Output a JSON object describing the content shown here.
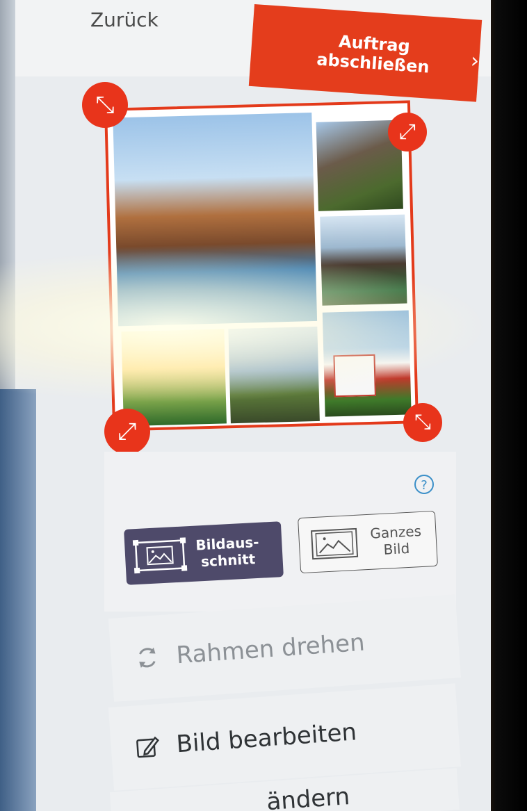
{
  "header": {
    "back_label": "Zurück",
    "finish_label": "Auftrag abschließen",
    "finish_chevron": "›"
  },
  "editor": {
    "help_label": "?",
    "handle_icons": [
      "resize-diagonal-icon",
      "resize-diagonal-icon",
      "resize-diagonal-icon",
      "resize-diagonal-icon"
    ],
    "modes": [
      {
        "id": "crop",
        "label_line1": "Bildaus-",
        "label_line2": "schnitt",
        "active": true
      },
      {
        "id": "full",
        "label_line1": "Ganzes",
        "label_line2": "Bild",
        "active": false
      }
    ],
    "menu": [
      {
        "id": "rotate",
        "label": "Rahmen drehen",
        "icon": "rotate-icon"
      },
      {
        "id": "edit",
        "label": "Bild bearbeiten",
        "icon": "edit-icon"
      },
      {
        "id": "change",
        "label": "ändern",
        "icon": ""
      }
    ]
  },
  "colors": {
    "accent": "#e43d1c",
    "active_mode": "#4e4a6a",
    "help": "#3a8fc8"
  }
}
